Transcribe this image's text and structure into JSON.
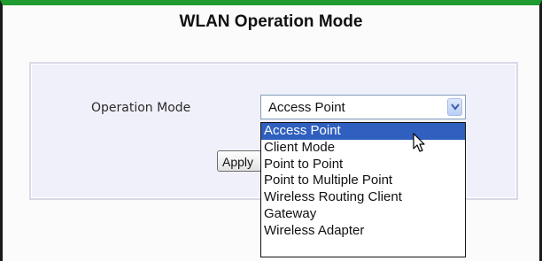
{
  "page": {
    "title": "WLAN Operation Mode"
  },
  "form": {
    "operation_mode_label": "Operation Mode",
    "selected_value": "Access Point",
    "apply_label": "Apply"
  },
  "dropdown": {
    "options": [
      "Access Point",
      "Client Mode",
      "Point to Point",
      "Point to Multiple Point",
      "Wireless Routing Client",
      "Gateway",
      "Wireless Adapter"
    ],
    "highlighted_index": 0
  },
  "colors": {
    "top_bar": "#1f9b2f",
    "panel_bg": "#f0f0fb",
    "highlight": "#2f5fbf"
  },
  "icons": {
    "select_arrow": "chevron-down-icon",
    "mouse_cursor": "mouse-pointer-icon"
  }
}
